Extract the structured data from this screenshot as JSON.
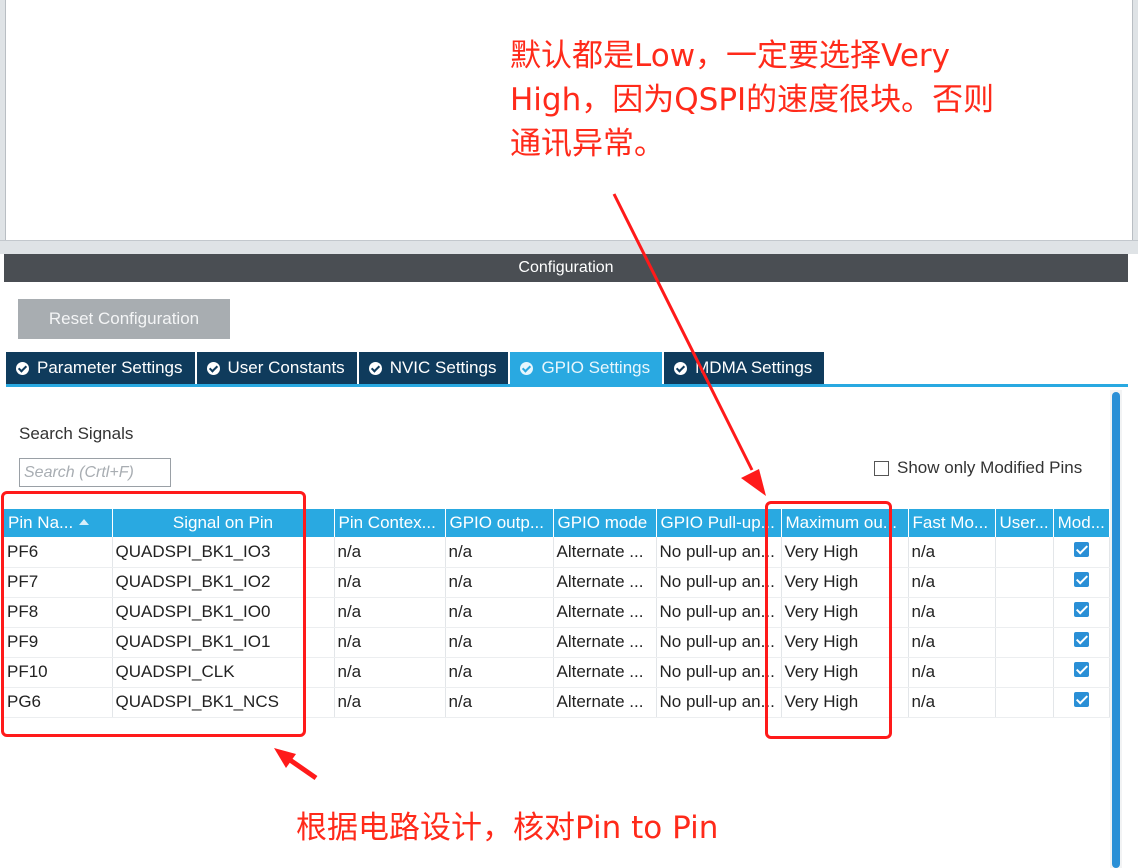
{
  "config_panel": {
    "title": "Configuration",
    "reset_label": "Reset Configuration"
  },
  "tabs": [
    {
      "label": "Parameter Settings",
      "active": false
    },
    {
      "label": "User Constants",
      "active": false
    },
    {
      "label": "NVIC Settings",
      "active": false
    },
    {
      "label": "GPIO Settings",
      "active": true
    },
    {
      "label": "MDMA Settings",
      "active": false
    }
  ],
  "search": {
    "label": "Search Signals",
    "placeholder": "Search (Crtl+F)",
    "value": ""
  },
  "show_modified": {
    "label": "Show only Modified Pins",
    "checked": false
  },
  "table": {
    "columns": [
      "Pin Na...",
      "Signal on Pin",
      "Pin Contex...",
      "GPIO outp...",
      "GPIO mode",
      "GPIO Pull-up...",
      "Maximum ou...",
      "Fast Mo...",
      "User...",
      "Mod..."
    ],
    "rows": [
      [
        "PF6",
        "QUADSPI_BK1_IO3",
        "n/a",
        "n/a",
        "Alternate ...",
        "No pull-up an...",
        "Very High",
        "n/a",
        "",
        true
      ],
      [
        "PF7",
        "QUADSPI_BK1_IO2",
        "n/a",
        "n/a",
        "Alternate ...",
        "No pull-up an...",
        "Very High",
        "n/a",
        "",
        true
      ],
      [
        "PF8",
        "QUADSPI_BK1_IO0",
        "n/a",
        "n/a",
        "Alternate ...",
        "No pull-up an...",
        "Very High",
        "n/a",
        "",
        true
      ],
      [
        "PF9",
        "QUADSPI_BK1_IO1",
        "n/a",
        "n/a",
        "Alternate ...",
        "No pull-up an...",
        "Very High",
        "n/a",
        "",
        true
      ],
      [
        "PF10",
        "QUADSPI_CLK",
        "n/a",
        "n/a",
        "Alternate ...",
        "No pull-up an...",
        "Very High",
        "n/a",
        "",
        true
      ],
      [
        "PG6",
        "QUADSPI_BK1_NCS",
        "n/a",
        "n/a",
        "Alternate ...",
        "No pull-up an...",
        "Very High",
        "n/a",
        "",
        true
      ]
    ]
  },
  "annotations": {
    "top": [
      "默认都是Low，一定要选择Very",
      "High，因为QSPI的速度很块。否则",
      "通讯异常。"
    ],
    "bottom": "根据电路设计，核对Pin to Pin",
    "color": "#ff2a1a"
  },
  "colors": {
    "accent": "#29a9e1",
    "tab_dark": "#0f3b5c",
    "header_dark": "#4a4e53",
    "checkbox": "#2a8fd6"
  }
}
